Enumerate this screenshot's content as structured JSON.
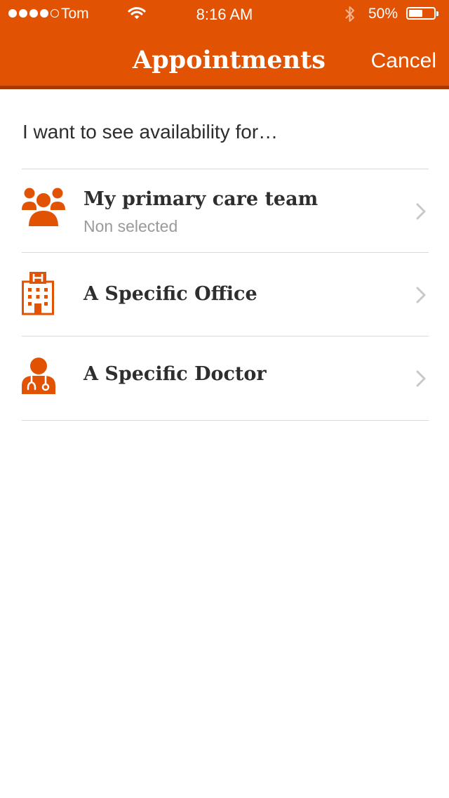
{
  "status_bar": {
    "carrier": "Tom",
    "time": "8:16 AM",
    "battery": "50%",
    "signal_bars_filled": 4,
    "signal_bars_total": 5
  },
  "nav": {
    "title": "Appointments",
    "cancel_label": "Cancel"
  },
  "prompt": "I want to see availability for…",
  "options": [
    {
      "title": "My primary care team",
      "subtitle": "Non selected",
      "icon": "team-icon"
    },
    {
      "title": "A Specific Office",
      "icon": "hospital-icon"
    },
    {
      "title": "A Specific Doctor",
      "icon": "doctor-icon"
    }
  ],
  "colors": {
    "brand": "#e25203",
    "brand_dark": "#a63a02",
    "text": "#2e2e2e",
    "subtext": "#9a9a9a",
    "chevron": "#c7c7cc",
    "divider": "#d9d9d9"
  }
}
